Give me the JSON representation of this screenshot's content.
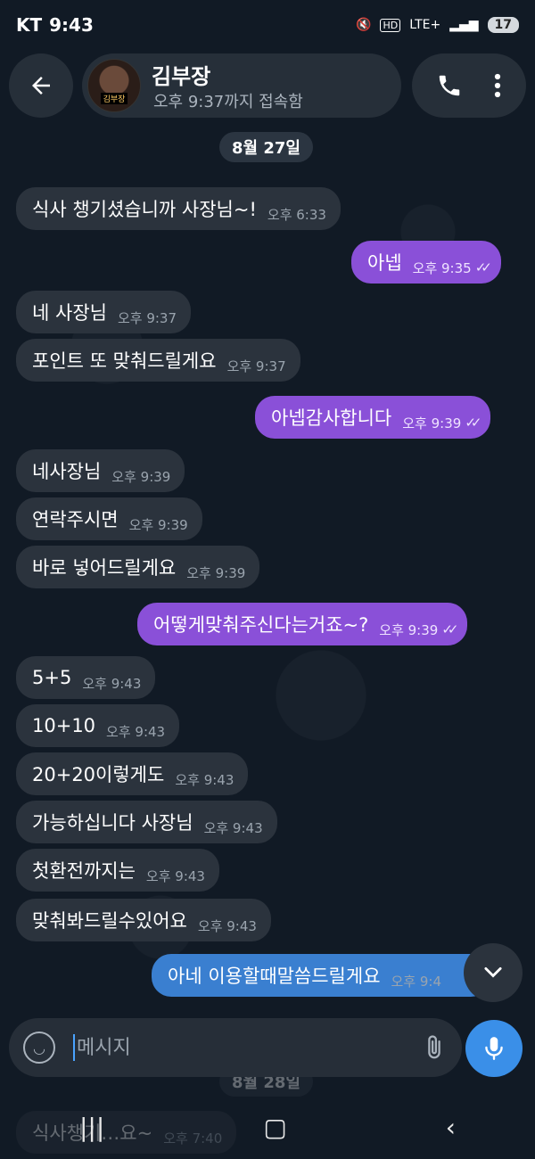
{
  "status": {
    "carrier": "KT",
    "time": "9:43",
    "network": "LTE+",
    "battery": "17"
  },
  "header": {
    "contact_name": "김부장",
    "last_seen": "오후 9:37까지 접속함",
    "avatar_tag": "김부장"
  },
  "date_chip": "8월 27일",
  "messages": [
    {
      "dir": "in",
      "text": "식사 챙기셨습니까 사장님~!",
      "time": "오후 6:33"
    },
    {
      "dir": "out",
      "text": "아넵",
      "time": "오후 9:35"
    },
    {
      "dir": "in",
      "text": "네 사장님",
      "time": "오후 9:37"
    },
    {
      "dir": "in",
      "text": "포인트 또 맞춰드릴게요",
      "time": "오후 9:37"
    },
    {
      "dir": "out",
      "text": "아넵감사합니다",
      "time": "오후 9:39"
    },
    {
      "dir": "in",
      "text": "네사장님",
      "time": "오후 9:39"
    },
    {
      "dir": "in",
      "text": "연락주시면",
      "time": "오후 9:39"
    },
    {
      "dir": "in",
      "text": "바로 넣어드릴게요",
      "time": "오후 9:39"
    },
    {
      "dir": "out",
      "text": "어떻게맞춰주신다는거죠~?",
      "time": "오후 9:39"
    },
    {
      "dir": "in",
      "text": "5+5",
      "time": "오후 9:43"
    },
    {
      "dir": "in",
      "text": "10+10",
      "time": "오후 9:43"
    },
    {
      "dir": "in",
      "text": "20+20이렇게도",
      "time": "오후 9:43"
    },
    {
      "dir": "in",
      "text": "가능하십니다 사장님",
      "time": "오후 9:43"
    },
    {
      "dir": "in",
      "text": "첫환전까지는",
      "time": "오후 9:43"
    },
    {
      "dir": "in",
      "text": "맞춰봐드릴수있어요",
      "time": "오후 9:43"
    },
    {
      "dir": "out",
      "text": "아네 이용할때말씀드릴게요",
      "time": "오후 9:4"
    }
  ],
  "next_date_chip": "8월 28일",
  "next_message": {
    "text": "식사챙기…요~",
    "time": "오후 7:40"
  },
  "input": {
    "placeholder": "메시지"
  },
  "colors": {
    "incoming": "#2b333d",
    "outgoing": "#8a50d8",
    "accent": "#3a8fe8"
  }
}
